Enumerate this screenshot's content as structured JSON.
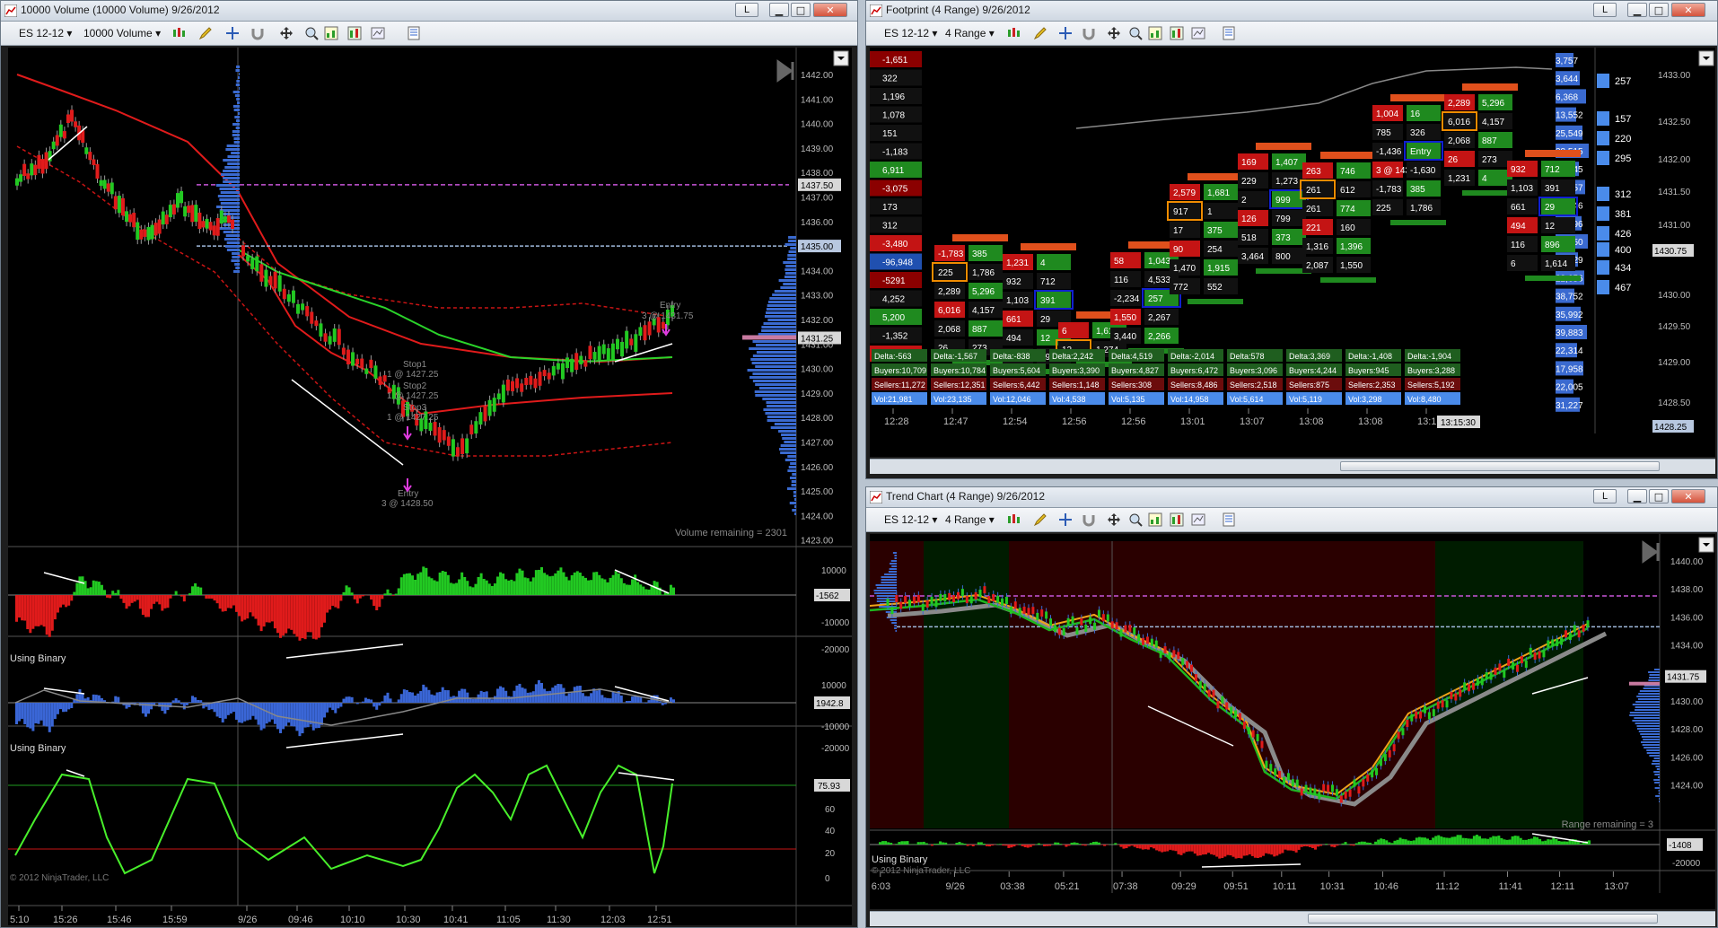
{
  "windows": {
    "volume": {
      "title": "10000 Volume (10000 Volume)  9/26/2012",
      "instrument": "ES 12-12",
      "period": "10000 Volume",
      "lock_label": "L",
      "price_labels": [
        "1442.00",
        "1441.00",
        "1440.00",
        "1439.00",
        "1438.00",
        "1437.50",
        "1437.00",
        "1436.00",
        "1435.00",
        "1434.00",
        "1433.00",
        "1432.00",
        "1431.25",
        "1431.00",
        "1430.00",
        "1429.00",
        "1428.00",
        "1427.00",
        "1426.00",
        "1425.00",
        "1424.00",
        "1423.00"
      ],
      "highlight_prices": {
        "current": "1431.25",
        "blue": "1435.00",
        "purple": "1437.50"
      },
      "annotations": {
        "entry_top": "Entry",
        "entry_top_val": "3 @ 1431.75",
        "stop1": "Stop1",
        "stop1_val": "1 @ 1427.25",
        "stop2": "Stop2",
        "stop2_val": "1 @ 1427.25",
        "stop3": "Stop3",
        "stop3_val": "1 @ 1427.25",
        "entry_bottom": "Entry",
        "entry_bottom_val": "3 @ 1428.50"
      },
      "volume_remaining": "Volume remaining = 2301",
      "panel2": {
        "label": "Using Binary",
        "ticks": [
          "10000",
          "-10000",
          "-20000"
        ],
        "value": "-1562"
      },
      "panel3": {
        "label": "Using Binary",
        "ticks": [
          "10000",
          "-10000",
          "-20000"
        ],
        "value": "1942.8"
      },
      "panel4": {
        "ticks": [
          "60",
          "40",
          "20",
          "0"
        ],
        "value": "75.93"
      },
      "copyright": "© 2012 NinjaTrader, LLC",
      "time_labels": [
        "5:10",
        "15:26",
        "15:46",
        "15:59",
        "9/26",
        "09:46",
        "10:10",
        "10:30",
        "10:41",
        "11:05",
        "11:30",
        "12:03",
        "12:51"
      ]
    },
    "footprint": {
      "title": "Footprint (4 Range)  9/26/2012",
      "instrument": "ES 12-12",
      "period": "4 Range",
      "lock_label": "L",
      "price_labels": [
        "1433.00",
        "1432.50",
        "1432.00",
        "1431.50",
        "1431.00",
        "1430.75",
        "1430.00",
        "1429.50",
        "1429.00",
        "1428.50",
        "1428.25"
      ],
      "left_col": [
        "-1,651",
        "322",
        "1,196",
        "1,078",
        "151",
        "-1,183",
        "6,911",
        "-3,075",
        "173",
        "312",
        "-3,480",
        "-96,948",
        "-5291",
        "4,252",
        "5,200",
        "-1,352",
        "-7,557"
      ],
      "right_col": [
        "3,757",
        "3,644",
        "6,368",
        "13,552",
        "25,549",
        "38,515",
        "31,945",
        "46,557",
        "25,546",
        "62,496",
        "44,150",
        "19,829",
        "22,656",
        "38,752",
        "35,992",
        "39,883",
        "22,314",
        "17,958",
        "22,005",
        "31,227"
      ],
      "vol_profile_labels": [
        "257",
        "157",
        "220",
        "295",
        "312",
        "381",
        "426",
        "400",
        "434",
        "467"
      ],
      "deltas": [
        "Delta:-563",
        "Delta:-1,567",
        "Delta:-838",
        "Delta:2,242",
        "Delta:4,519",
        "Delta:-2,014",
        "Delta:578",
        "Delta:3,369",
        "Delta:-1,408",
        "Delta:-1,904"
      ],
      "buyers": [
        "Buyers:10,709",
        "Buyers:10,784",
        "Buyers:5,604",
        "Buyers:3,390",
        "Buyers:4,827",
        "Buyers:6,472",
        "Buyers:3,096",
        "Buyers:4,244",
        "Buyers:945",
        "Buyers:3,288"
      ],
      "sellers": [
        "Sellers:11,272",
        "Sellers:12,351",
        "Sellers:6,442",
        "Sellers:1,148",
        "Sellers:308",
        "Sellers:8,486",
        "Sellers:2,518",
        "Sellers:875",
        "Sellers:2,353",
        "Sellers:5,192"
      ],
      "vols": [
        "Vol:21,981",
        "Vol:23,135",
        "Vol:12,046",
        "Vol:4,538",
        "Vol:5,135",
        "Vol:14,958",
        "Vol:5,614",
        "Vol:5,119",
        "Vol:3,298",
        "Vol:8,480"
      ],
      "time_labels": [
        "12:28",
        "12:47",
        "12:54",
        "12:56",
        "12:56",
        "13:01",
        "13:07",
        "13:08",
        "13:08",
        "13:15"
      ],
      "current_time": "13:15:30",
      "cells": [
        "-1,783",
        "385",
        "225",
        "1,786",
        "2,289",
        "5,296",
        "6,016",
        "4,157",
        "2,068",
        "887",
        "26",
        "273",
        "1,231",
        "4",
        "932",
        "712",
        "1,103",
        "391",
        "661",
        "29",
        "494",
        "12",
        "116",
        "896",
        "6",
        "1,614",
        "12",
        "1,274",
        "58",
        "1,043",
        "116",
        "4,533",
        "-2,234",
        "257",
        "1,550",
        "2,267",
        "3,440",
        "2,266",
        "2,579",
        "1,681",
        "917",
        "1",
        "17",
        "375",
        "90",
        "254",
        "1,470",
        "1,915",
        "772",
        "552",
        "169",
        "1,407",
        "229",
        "1,273",
        "2",
        "999",
        "126",
        "799",
        "518",
        "373",
        "3,464",
        "800",
        "263",
        "746",
        "261",
        "612",
        "261",
        "774",
        "221",
        "160",
        "1,316",
        "1,396",
        "2,087",
        "1,550",
        "1,004",
        "16",
        "785",
        "326",
        "-1,436",
        "Entry",
        "3 @ 1431.75",
        "-1,630"
      ]
    },
    "trend": {
      "title": "Trend Chart (4 Range)  9/26/2012",
      "instrument": "ES 12-12",
      "period": "4 Range",
      "lock_label": "L",
      "price_labels": [
        "1440.00",
        "1438.00",
        "1436.00",
        "1434.00",
        "1432.00",
        "1431.75",
        "1430.00",
        "1428.00",
        "1426.00",
        "1424.00"
      ],
      "range_remaining": "Range remaining = 3",
      "panel2": {
        "label": "Using Binary",
        "ticks": [
          "-20000"
        ],
        "value": "-1408"
      },
      "copyright": "© 2012 NinjaTrader, LLC",
      "time_labels": [
        "6:03",
        "9/26",
        "03:38",
        "05:21",
        "07:38",
        "09:29",
        "09:51",
        "10:11",
        "10:31",
        "10:46",
        "11:12",
        "11:41",
        "12:11",
        "13:07"
      ]
    }
  },
  "colors": {
    "bull": "#22c922",
    "bear": "#e01b1b",
    "blue_hist": "#3a66d6",
    "osc": "#48ef2b",
    "purple": "#c855d8",
    "steel": "#a8c0e0"
  }
}
